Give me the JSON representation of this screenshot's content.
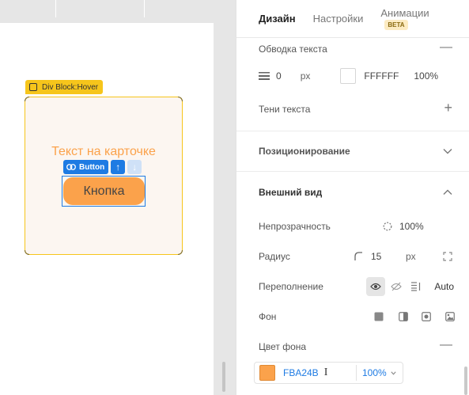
{
  "canvas": {
    "selection_label": "Div Block:Hover",
    "card_text": "Текст на карточке",
    "button_tag_label": "Button",
    "button_label": "Кнопка",
    "colors": {
      "card_bg": "#fcf6f1",
      "accent": "#fba24b",
      "selection": "#f6c51b",
      "focus": "#1e7be3"
    }
  },
  "tabs": [
    {
      "label": "Дизайн",
      "active": true
    },
    {
      "label": "Настройки",
      "active": false
    },
    {
      "label": "Анимации",
      "active": false,
      "badge": "BETA"
    }
  ],
  "text_stroke": {
    "title": "Обводка текста",
    "width": "0",
    "unit": "px",
    "color": "FFFFFF",
    "opacity": "100%"
  },
  "text_shadows": {
    "title": "Тени текста"
  },
  "positioning": {
    "title": "Позиционирование"
  },
  "appearance": {
    "title": "Внешний вид",
    "opacity_label": "Непрозрачность",
    "opacity_value": "100%",
    "radius_label": "Радиус",
    "radius_value": "15",
    "radius_unit": "px",
    "overflow_label": "Переполнение",
    "overflow_auto": "Auto",
    "background_label": "Фон",
    "bg_color_label": "Цвет фона",
    "bg_color_value": "FBA24B",
    "bg_color_swatch": "#fba24b",
    "bg_color_opacity": "100%"
  }
}
